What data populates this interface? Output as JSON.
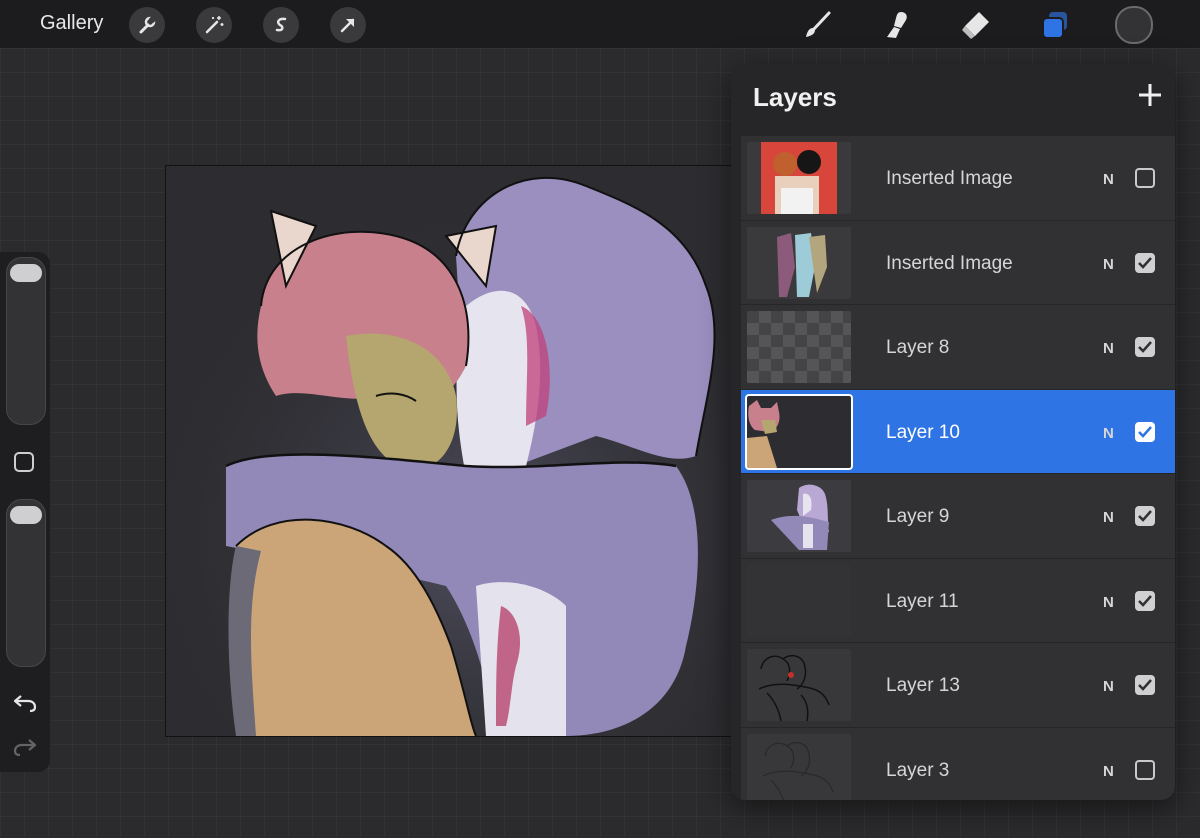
{
  "topbar": {
    "gallery_label": "Gallery",
    "left_tools": [
      "wrench-icon",
      "magic-wand-icon",
      "selection-icon",
      "transform-arrow-icon"
    ],
    "right_tools": [
      "brush-icon",
      "smudge-icon",
      "eraser-icon",
      "layers-icon"
    ],
    "active_tool": "layers-icon",
    "current_color": "#333335",
    "accent_color": "#2f74e4"
  },
  "sidebar": {
    "controls": [
      "brush-size-slider",
      "modify-button",
      "opacity-slider",
      "undo-icon",
      "redo-icon"
    ]
  },
  "layers_panel": {
    "title": "Layers",
    "add_icon": "plus-icon",
    "layers": [
      {
        "name": "Inserted Image",
        "blend": "N",
        "visible": false,
        "selected": false
      },
      {
        "name": "Inserted Image",
        "blend": "N",
        "visible": true,
        "selected": false
      },
      {
        "name": "Layer 8",
        "blend": "N",
        "visible": true,
        "selected": false
      },
      {
        "name": "Layer 10",
        "blend": "N",
        "visible": true,
        "selected": true
      },
      {
        "name": "Layer 9",
        "blend": "N",
        "visible": true,
        "selected": false
      },
      {
        "name": "Layer 11",
        "blend": "N",
        "visible": true,
        "selected": false
      },
      {
        "name": "Layer 13",
        "blend": "N",
        "visible": true,
        "selected": false
      },
      {
        "name": "Layer 3",
        "blend": "N",
        "visible": false,
        "selected": false
      }
    ]
  }
}
